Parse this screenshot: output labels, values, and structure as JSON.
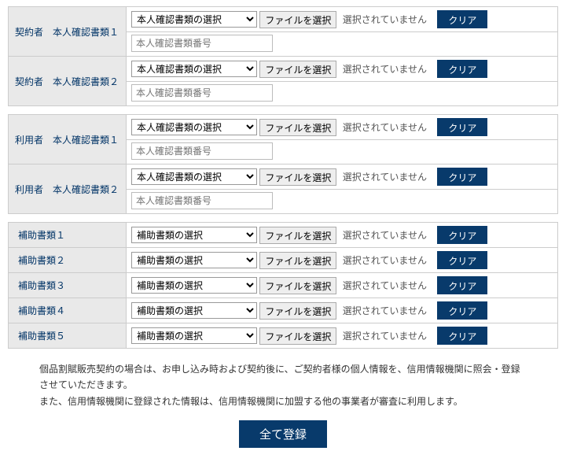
{
  "section1": [
    {
      "label": "契約者　本人確認書類１",
      "select": "本人確認書類の選択",
      "file_btn": "ファイルを選択",
      "file_text": "選択されていません",
      "clear": "クリア",
      "num_ph": "本人確認書類番号"
    },
    {
      "label": "契約者　本人確認書類２",
      "select": "本人確認書類の選択",
      "file_btn": "ファイルを選択",
      "file_text": "選択されていません",
      "clear": "クリア",
      "num_ph": "本人確認書類番号"
    }
  ],
  "section2": [
    {
      "label": "利用者　本人確認書類１",
      "select": "本人確認書類の選択",
      "file_btn": "ファイルを選択",
      "file_text": "選択されていません",
      "clear": "クリア",
      "num_ph": "本人確認書類番号"
    },
    {
      "label": "利用者　本人確認書類２",
      "select": "本人確認書類の選択",
      "file_btn": "ファイルを選択",
      "file_text": "選択されていません",
      "clear": "クリア",
      "num_ph": "本人確認書類番号"
    }
  ],
  "section3": [
    {
      "label": "補助書類１",
      "select": "補助書類の選択",
      "file_btn": "ファイルを選択",
      "file_text": "選択されていません",
      "clear": "クリア"
    },
    {
      "label": "補助書類２",
      "select": "補助書類の選択",
      "file_btn": "ファイルを選択",
      "file_text": "選択されていません",
      "clear": "クリア"
    },
    {
      "label": "補助書類３",
      "select": "補助書類の選択",
      "file_btn": "ファイルを選択",
      "file_text": "選択されていません",
      "clear": "クリア"
    },
    {
      "label": "補助書類４",
      "select": "補助書類の選択",
      "file_btn": "ファイルを選択",
      "file_text": "選択されていません",
      "clear": "クリア"
    },
    {
      "label": "補助書類５",
      "select": "補助書類の選択",
      "file_btn": "ファイルを選択",
      "file_text": "選択されていません",
      "clear": "クリア"
    }
  ],
  "notice_line1": "個品割賦販売契約の場合は、お申し込み時および契約後に、ご契約者様の個人情報を、信用情報機関に照会・登録させていただきます。",
  "notice_line2": "また、信用情報機関に登録された情報は、信用情報機関に加盟する他の事業者が審査に利用します。",
  "submit": "全て登録"
}
